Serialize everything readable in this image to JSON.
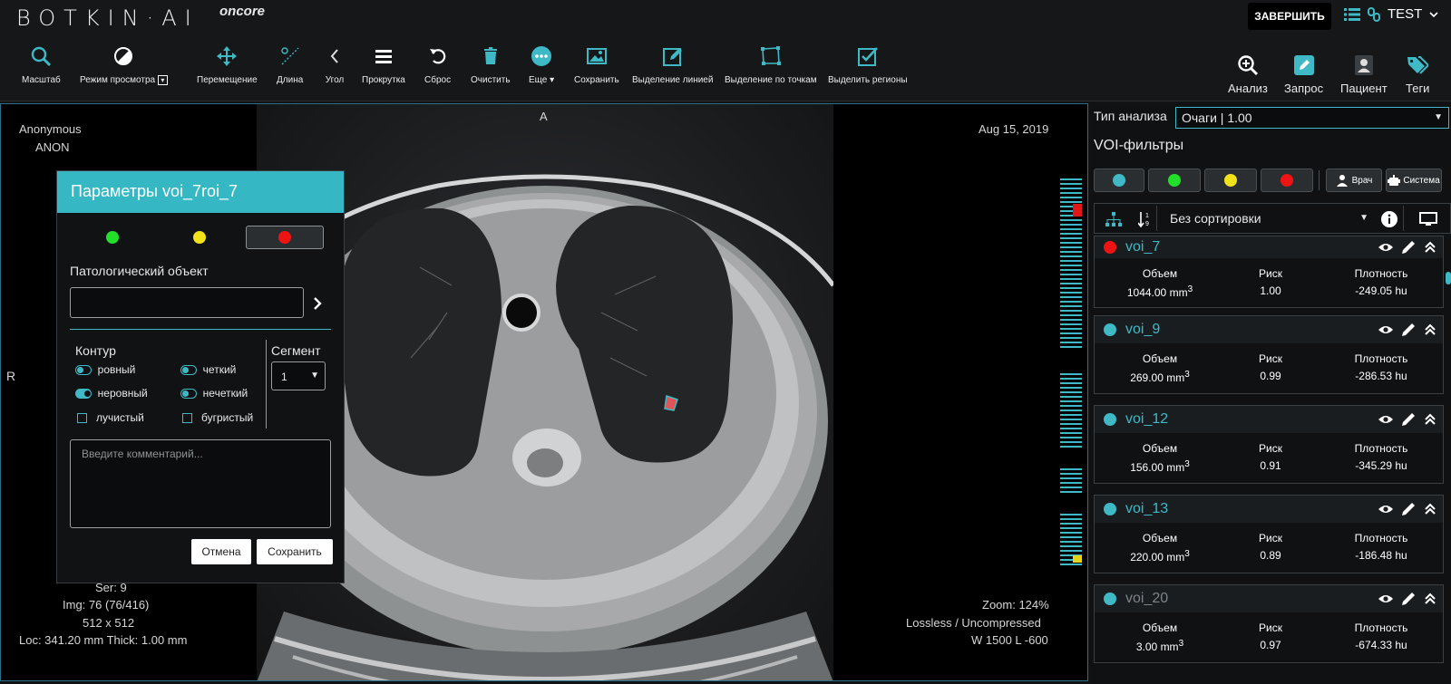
{
  "header": {
    "logo": "BOTKIN·AI",
    "logo_sub": "oncore",
    "finish_label": "ЗАВЕРШИТЬ",
    "user": "TEST"
  },
  "toolbar": {
    "tools": [
      {
        "name": "zoom",
        "label": "Масштаб",
        "icon": "magnifier-icon"
      },
      {
        "name": "view-mode",
        "label": "Режим просмотра",
        "icon": "contrast-icon"
      },
      {
        "name": "pan",
        "label": "Перемещение",
        "icon": "move-icon"
      },
      {
        "name": "length",
        "label": "Длина",
        "icon": "ruler-icon"
      },
      {
        "name": "angle",
        "label": "Угол",
        "icon": "angle-icon"
      },
      {
        "name": "scroll",
        "label": "Прокрутка",
        "icon": "stack-icon"
      },
      {
        "name": "reset",
        "label": "Сброс",
        "icon": "undo-icon"
      },
      {
        "name": "clear",
        "label": "Очистить",
        "icon": "trash-icon"
      },
      {
        "name": "more",
        "label": "Еще",
        "icon": "dots-icon"
      },
      {
        "name": "save",
        "label": "Сохранить",
        "icon": "image-icon"
      },
      {
        "name": "line-select",
        "label": "Выделение линией",
        "icon": "pencil-box-icon"
      },
      {
        "name": "point-select",
        "label": "Выделение по точкам",
        "icon": "polygon-icon"
      },
      {
        "name": "select-regions",
        "label": "Выделить регионы",
        "icon": "check-box-icon"
      }
    ],
    "right": [
      {
        "name": "analysis",
        "label": "Анализ",
        "icon": "zoom-plus-icon"
      },
      {
        "name": "request",
        "label": "Запрос",
        "icon": "edit-icon"
      },
      {
        "name": "patient",
        "label": "Пациент",
        "icon": "patient-icon"
      },
      {
        "name": "tags",
        "label": "Теги",
        "icon": "tags-icon"
      }
    ]
  },
  "viewer": {
    "patient_name": "Anonymous",
    "patient_id": "ANON",
    "date": "Aug 15, 2019",
    "orientation_top": "A",
    "orientation_left": "R",
    "ser": "Ser: 9",
    "img": "Img: 76 (76/416)",
    "size": "512 x 512",
    "loc": "Loc: 341.20 mm Thick: 1.00 mm",
    "zoom": "Zoom: 124%",
    "compression": "Lossless / Uncompressed",
    "window": "W 1500 L -600"
  },
  "dialog": {
    "title": "Параметры voi_7roi_7",
    "patho_label": "Патологический объект",
    "contour_label": "Контур",
    "segment_label": "Сегмент",
    "segment_value": "1",
    "options": [
      {
        "label": "ровный",
        "type": "toggle",
        "on": false
      },
      {
        "label": "четкий",
        "type": "toggle",
        "on": false
      },
      {
        "label": "неровный",
        "type": "toggle",
        "on": true
      },
      {
        "label": "нечеткий",
        "type": "toggle",
        "on": false
      },
      {
        "label": "лучистый",
        "type": "checkbox",
        "on": false
      },
      {
        "label": "бугристый",
        "type": "checkbox",
        "on": false
      }
    ],
    "comment_placeholder": "Введите комментарий...",
    "cancel_label": "Отмена",
    "save_label": "Сохранить",
    "colors": {
      "green": "#22e02a",
      "yellow": "#f2e21a",
      "red": "#ee1414"
    }
  },
  "panel": {
    "analysis_type_label": "Тип анализа",
    "analysis_type_value": "Очаги | 1.00",
    "filters_label": "VOI-фильтры",
    "doctor_label": "Врач",
    "system_label": "Система",
    "sort_value": "Без сортировки",
    "vol_label": "Объем",
    "risk_label": "Риск",
    "density_label": "Плотность",
    "unit": "mm",
    "unit_exp": "3",
    "vois": [
      {
        "name": "voi_7",
        "color": "#ee1414",
        "volume": "1044.00",
        "risk": "1.00",
        "density": "-249.05 hu"
      },
      {
        "name": "voi_9",
        "color": "#3fb9c6",
        "volume": "269.00",
        "risk": "0.99",
        "density": "-286.53 hu"
      },
      {
        "name": "voi_12",
        "color": "#3fb9c6",
        "volume": "156.00",
        "risk": "0.91",
        "density": "-345.29 hu"
      },
      {
        "name": "voi_13",
        "color": "#3fb9c6",
        "volume": "220.00",
        "risk": "0.89",
        "density": "-186.48 hu"
      },
      {
        "name": "voi_20",
        "color": "#3fb9c6",
        "volume": "3.00",
        "risk": "0.97",
        "density": "-674.33 hu"
      }
    ]
  }
}
